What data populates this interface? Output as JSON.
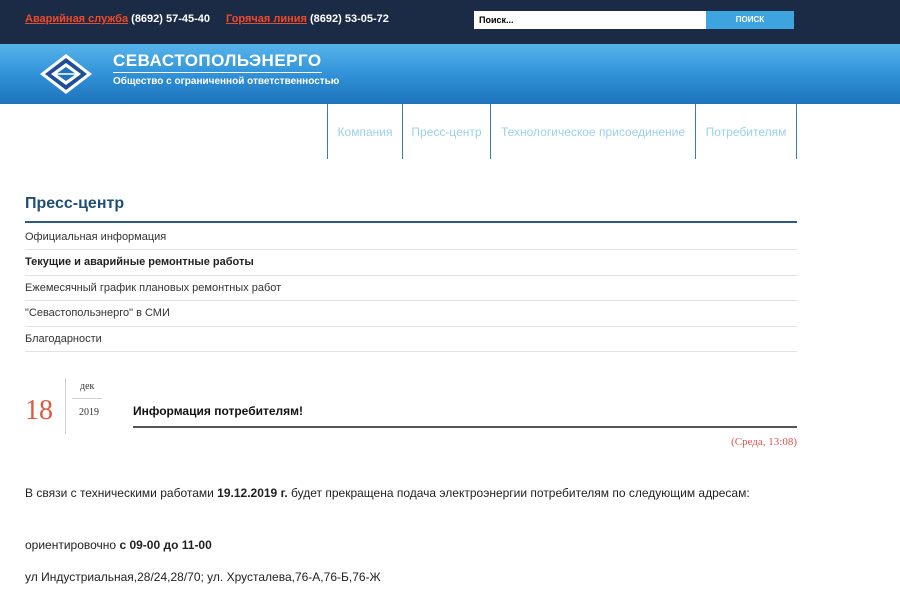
{
  "topbar": {
    "emergency_label": "Аварийная служба",
    "emergency_phone": "(8692) 57-45-40",
    "hotline_label": "Горячая линия",
    "hotline_phone": "(8692) 53-05-72",
    "search_placeholder": "Поиск...",
    "search_button": "ПОИСК"
  },
  "brand": {
    "name": "СЕВАСТОПОЛЬЭНЕРГО",
    "subtitle": "Общество с ограниченной ответственностью",
    "logo_icon": "diamond-logo-icon"
  },
  "nav": {
    "items": [
      {
        "label": "Компания"
      },
      {
        "label": "Пресс-центр"
      },
      {
        "label": "Технологическое присоединение"
      },
      {
        "label": "Потребителям"
      }
    ]
  },
  "section": {
    "title": "Пресс-центр",
    "submenu": [
      {
        "label": "Официальная информация",
        "active": false
      },
      {
        "label": "Текущие и аварийные ремонтные работы",
        "active": true
      },
      {
        "label": "Ежемесячный график плановых ремонтных работ",
        "active": false
      },
      {
        "label": "\"Севастопольэнерго\" в СМИ",
        "active": false
      },
      {
        "label": "Благодарности",
        "active": false
      }
    ]
  },
  "news": {
    "day": "18",
    "month": "дек",
    "year": "2019",
    "title": "Информация потребителям!",
    "timestamp": "(Среда, 13:08)",
    "p1_before": "В связи с техническими  работами  ",
    "p1_date": "19.12.2019 г.",
    "p1_after": "  будет прекращена подача электроэнергии потребителям по следующим адресам:",
    "p2_before": "ориентировочно ",
    "p2_time": "с 09-00 до 11-00",
    "p3": "ул Индустриальная,28/24,28/70; ул. Хрусталева,76-А,76-Б,76-Ж"
  },
  "colors": {
    "topbar_bg": "#1b2a45",
    "link_accent": "#f04a2c",
    "banner_blue": "#2e8fd6",
    "nav_text": "#9ad2ea",
    "section_title": "#1f4f75",
    "date_accent": "#e05a3b"
  }
}
